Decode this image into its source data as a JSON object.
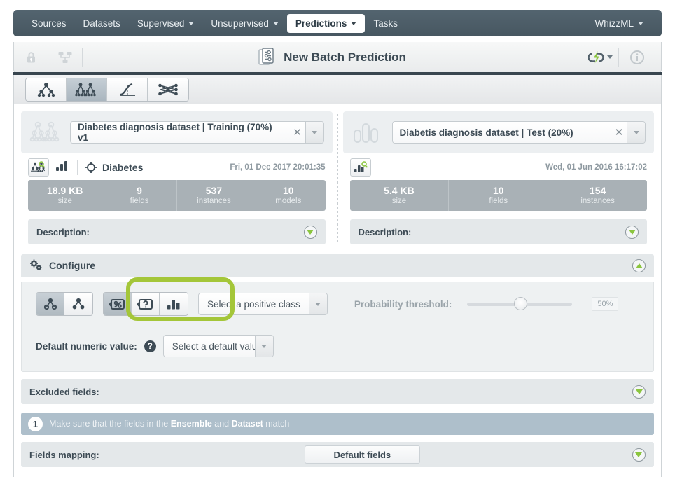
{
  "nav": {
    "items": [
      {
        "label": "Sources",
        "caret": false,
        "active": false
      },
      {
        "label": "Datasets",
        "caret": false,
        "active": false
      },
      {
        "label": "Supervised",
        "caret": true,
        "active": false
      },
      {
        "label": "Unsupervised",
        "caret": true,
        "active": false
      },
      {
        "label": "Predictions",
        "caret": true,
        "active": true
      },
      {
        "label": "Tasks",
        "caret": false,
        "active": false
      }
    ],
    "right_label": "WhizzML"
  },
  "titlebar": {
    "title": "New Batch Prediction",
    "lock_icon": "lock-icon",
    "share_icon": "share-network-icon",
    "resource_icon": "batch-prediction-icon",
    "bigml_icon": "bigml-lightning-icon",
    "info_icon": "info-circle-icon"
  },
  "typebar": {
    "buttons": [
      {
        "name": "model-icon",
        "selected": false
      },
      {
        "name": "ensemble-icon",
        "selected": true
      },
      {
        "name": "logistic-regression-icon",
        "selected": false
      },
      {
        "name": "deepnet-icon",
        "selected": false
      }
    ]
  },
  "left_panel": {
    "icon": "ensemble-icon",
    "selection": "Diabetes diagnosis dataset | Training (70%) v1",
    "clear_icon": "close-icon",
    "resource_icon": "ensemble-search-icon",
    "dataset_icon": "dataset-bars-icon",
    "objective_icon": "objective-target-icon",
    "name": "Diabetes",
    "date": "Fri, 01 Dec 2017 20:01:35",
    "stats": [
      {
        "value": "18.9 KB",
        "label": "size"
      },
      {
        "value": "9",
        "label": "fields"
      },
      {
        "value": "537",
        "label": "instances"
      },
      {
        "value": "10",
        "label": "models"
      }
    ],
    "description_label": "Description:"
  },
  "right_panel": {
    "icon": "dataset-bars-icon",
    "selection": "Diabetis diagnosis dataset | Test (20%)",
    "clear_icon": "close-icon",
    "resource_icon": "dataset-search-icon",
    "date": "Wed, 01 Jun 2016 16:17:02",
    "stats": [
      {
        "value": "5.4 KB",
        "label": "size"
      },
      {
        "value": "10",
        "label": "fields"
      },
      {
        "value": "154",
        "label": "instances"
      }
    ],
    "description_label": "Description:"
  },
  "configure": {
    "title": "Configure",
    "gear_icon": "gears-icon",
    "collapse_icon": "chevron-up-circle-icon",
    "prediction_type_buttons": [
      {
        "name": "single-prediction-icon",
        "selected": true
      },
      {
        "name": "all-predictions-icon",
        "selected": false
      }
    ],
    "output_buttons": [
      {
        "name": "percent-braces-icon",
        "selected": true
      },
      {
        "name": "question-braces-icon",
        "selected": false
      },
      {
        "name": "histogram-icon",
        "selected": false
      }
    ],
    "highlight_color": "#a4c639",
    "positive_class_placeholder": "Select a positive class",
    "threshold_label": "Probability threshold:",
    "threshold_value": "50%",
    "default_numeric_label": "Default numeric value:",
    "default_numeric_help": "?",
    "default_numeric_placeholder": "Select a default value"
  },
  "excluded_fields": {
    "label": "Excluded fields:",
    "expand_icon": "chevron-down-circle-icon"
  },
  "notice": {
    "number": "1",
    "text_before": "Make sure that the fields in the ",
    "bold_1": "Ensemble",
    "text_mid": " and ",
    "bold_2": "Dataset",
    "text_after": " match"
  },
  "fields_mapping": {
    "label": "Fields mapping:",
    "button_label": "Default fields",
    "expand_icon": "chevron-down-circle-icon"
  }
}
